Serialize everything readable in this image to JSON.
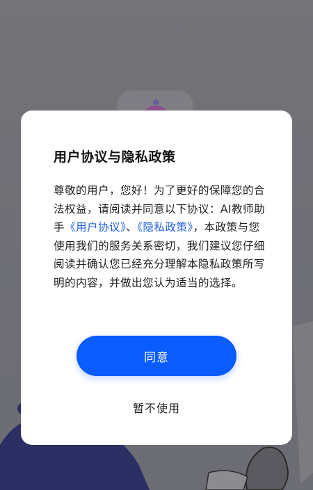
{
  "dialog": {
    "title": "用户协议与隐私政策",
    "body_intro": "尊敬的用户，您好！为了更好的保障您的合法权益，请阅读并同意以下协议：AI教师助手",
    "user_agreement_link": "《用户协议》",
    "separator": "、",
    "privacy_policy_link": "《隐私政策》",
    "body_rest": "，本政策与您使用我们的服务关系密切，我们建议您仔细阅读并确认您已经充分理解本隐私政策所写明的内容，并做出您认为适当的选择。",
    "agree_label": "同意",
    "decline_label": "暂不使用"
  },
  "colors": {
    "overlay": "#6e6e74",
    "dialog_background": "#ffffff",
    "primary_button": "#0a5cff",
    "link": "#1f5fe0",
    "text": "#222222"
  },
  "icons": {
    "app_logo": "robot-logo-icon"
  }
}
